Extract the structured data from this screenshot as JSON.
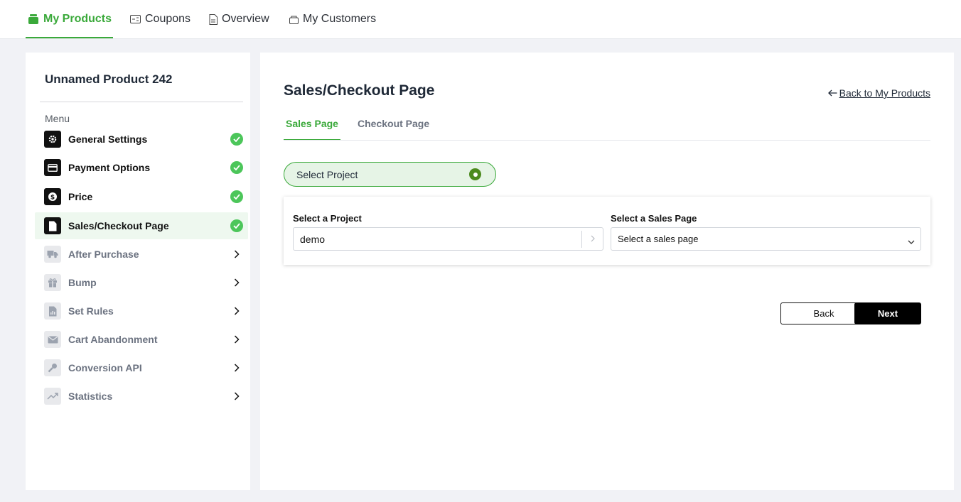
{
  "topnav": {
    "tabs": [
      {
        "label": "My Products",
        "icon": "store-icon",
        "active": true
      },
      {
        "label": "Coupons",
        "icon": "coupon-icon",
        "active": false
      },
      {
        "label": "Overview",
        "icon": "document-icon",
        "active": false
      },
      {
        "label": "My Customers",
        "icon": "customers-icon",
        "active": false
      }
    ]
  },
  "sidebar": {
    "product_title": "Unnamed Product 242",
    "menu_label": "Menu",
    "items": [
      {
        "label": "General Settings",
        "icon": "gear-icon",
        "status": "complete"
      },
      {
        "label": "Payment Options",
        "icon": "card-icon",
        "status": "complete"
      },
      {
        "label": "Price",
        "icon": "dollar-icon",
        "status": "complete"
      },
      {
        "label": "Sales/Checkout Page",
        "icon": "page-icon",
        "status": "complete",
        "active": true
      },
      {
        "label": "After Purchase",
        "icon": "truck-icon",
        "status": "pending"
      },
      {
        "label": "Bump",
        "icon": "gift-icon",
        "status": "pending"
      },
      {
        "label": "Set Rules",
        "icon": "rules-icon",
        "status": "pending"
      },
      {
        "label": "Cart Abandonment",
        "icon": "mail-icon",
        "status": "pending"
      },
      {
        "label": "Conversion API",
        "icon": "key-icon",
        "status": "pending"
      },
      {
        "label": "Statistics",
        "icon": "trend-icon",
        "status": "pending"
      }
    ]
  },
  "main": {
    "title": "Sales/Checkout Page",
    "back_link": "Back to My Products",
    "tabs": [
      {
        "label": "Sales Page",
        "active": true
      },
      {
        "label": "Checkout Page",
        "active": false
      }
    ],
    "step_pill": "Select Project",
    "project_field": {
      "label": "Select a Project",
      "value": "demo"
    },
    "sales_page_field": {
      "label": "Select a Sales Page",
      "value": "Select a sales page"
    },
    "back_button": "Back",
    "next_button": "Next"
  },
  "colors": {
    "accent": "#3aa93a",
    "check": "#4cc65a",
    "pill_bg": "#e6f4e6"
  }
}
